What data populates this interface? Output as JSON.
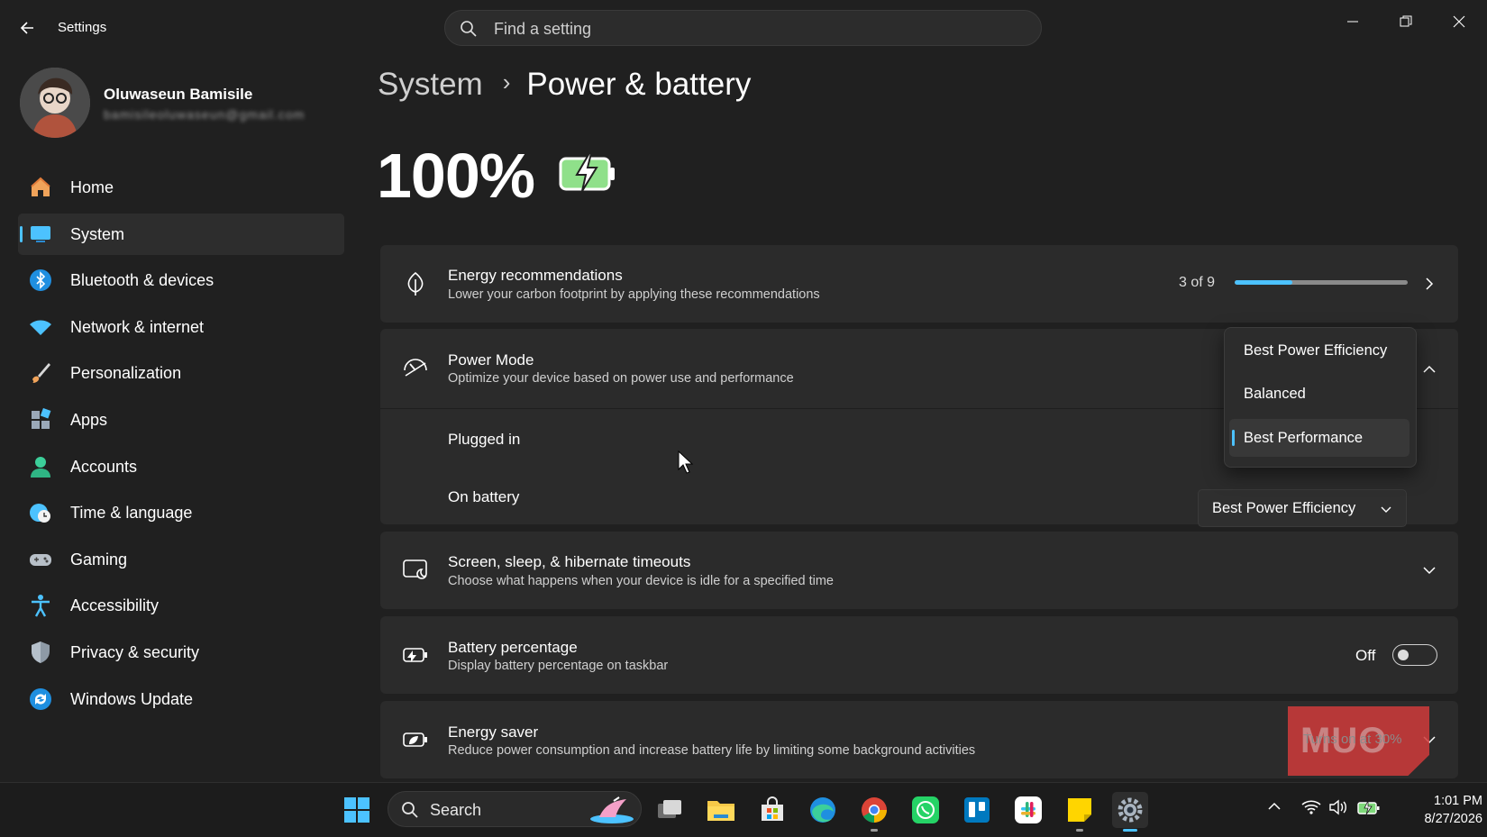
{
  "window": {
    "title": "Settings"
  },
  "search": {
    "placeholder": "Find a setting"
  },
  "profile": {
    "name": "Oluwaseun Bamisile",
    "email": "bamisileoluwaseun@gmail.com"
  },
  "sidebar": {
    "items": [
      {
        "label": "Home",
        "icon": "home-icon"
      },
      {
        "label": "System",
        "icon": "system-icon",
        "active": true
      },
      {
        "label": "Bluetooth & devices",
        "icon": "bluetooth-icon"
      },
      {
        "label": "Network & internet",
        "icon": "wifi-icon"
      },
      {
        "label": "Personalization",
        "icon": "brush-icon"
      },
      {
        "label": "Apps",
        "icon": "apps-icon"
      },
      {
        "label": "Accounts",
        "icon": "accounts-icon"
      },
      {
        "label": "Time & language",
        "icon": "globe-clock-icon"
      },
      {
        "label": "Gaming",
        "icon": "gamepad-icon"
      },
      {
        "label": "Accessibility",
        "icon": "accessibility-icon"
      },
      {
        "label": "Privacy & security",
        "icon": "shield-icon"
      },
      {
        "label": "Windows Update",
        "icon": "update-icon"
      }
    ]
  },
  "breadcrumb": {
    "parent": "System",
    "separator": "›",
    "current": "Power & battery"
  },
  "battery": {
    "percent": "100%",
    "charging": true
  },
  "energy_recommendations": {
    "title": "Energy recommendations",
    "subtitle": "Lower your carbon footprint by applying these recommendations",
    "count_label": "3 of 9",
    "progress_fraction": 0.333
  },
  "power_mode": {
    "title": "Power Mode",
    "subtitle": "Optimize your device based on power use and performance",
    "plugged_in_label": "Plugged in",
    "on_battery_label": "On battery",
    "on_battery_value": "Best Power Efficiency",
    "menu_options": [
      "Best Power Efficiency",
      "Balanced",
      "Best Performance"
    ],
    "menu_selected": "Best Performance"
  },
  "screen_sleep": {
    "title": "Screen, sleep, & hibernate timeouts",
    "subtitle": "Choose what happens when your device is idle for a specified time"
  },
  "battery_percentage": {
    "title": "Battery percentage",
    "subtitle": "Display battery percentage on taskbar",
    "toggle_label": "Off",
    "enabled": false
  },
  "energy_saver": {
    "title": "Energy saver",
    "subtitle": "Reduce power consumption and increase battery life by limiting some background activities",
    "status": "Turns on at 30%"
  },
  "watermark": {
    "text": "MUO"
  },
  "taskbar": {
    "search_label": "Search",
    "apps": [
      "windows-start-icon",
      "task-view-icon",
      "file-explorer-icon",
      "microsoft-store-icon",
      "edge-icon",
      "chrome-icon",
      "whatsapp-icon",
      "trello-icon",
      "slack-icon",
      "sticky-notes-icon",
      "settings-icon"
    ],
    "time": "1:01 PM",
    "date": "8/27/2026"
  },
  "colors": {
    "accent": "#4cc2ff",
    "background": "#202020",
    "card": "#2b2b2b",
    "battery_green": "#7ed87a"
  }
}
